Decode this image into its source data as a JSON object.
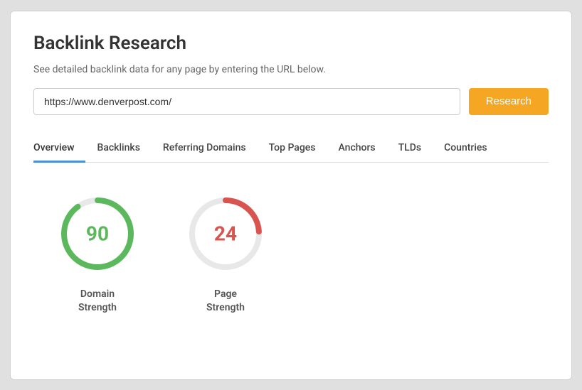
{
  "page": {
    "title": "Backlink Research",
    "subtitle": "See detailed backlink data for any page by entering the URL below.",
    "search": {
      "placeholder": "https://www.denverpost.com/",
      "value": "https://www.denverpost.com/",
      "button_label": "Research"
    },
    "tabs": [
      {
        "id": "overview",
        "label": "Overview",
        "active": true
      },
      {
        "id": "backlinks",
        "label": "Backlinks",
        "active": false
      },
      {
        "id": "referring-domains",
        "label": "Referring Domains",
        "active": false
      },
      {
        "id": "top-pages",
        "label": "Top Pages",
        "active": false
      },
      {
        "id": "anchors",
        "label": "Anchors",
        "active": false
      },
      {
        "id": "tlds",
        "label": "TLDs",
        "active": false
      },
      {
        "id": "countries",
        "label": "Countries",
        "active": false
      }
    ],
    "metrics": [
      {
        "id": "domain-strength",
        "value": "90",
        "label": "Domain\nStrength",
        "color_class": "label-green",
        "circle_type": "green",
        "percentage": 90
      },
      {
        "id": "page-strength",
        "value": "24",
        "label": "Page\nStrength",
        "color_class": "label-red",
        "circle_type": "red",
        "percentage": 24
      }
    ]
  }
}
